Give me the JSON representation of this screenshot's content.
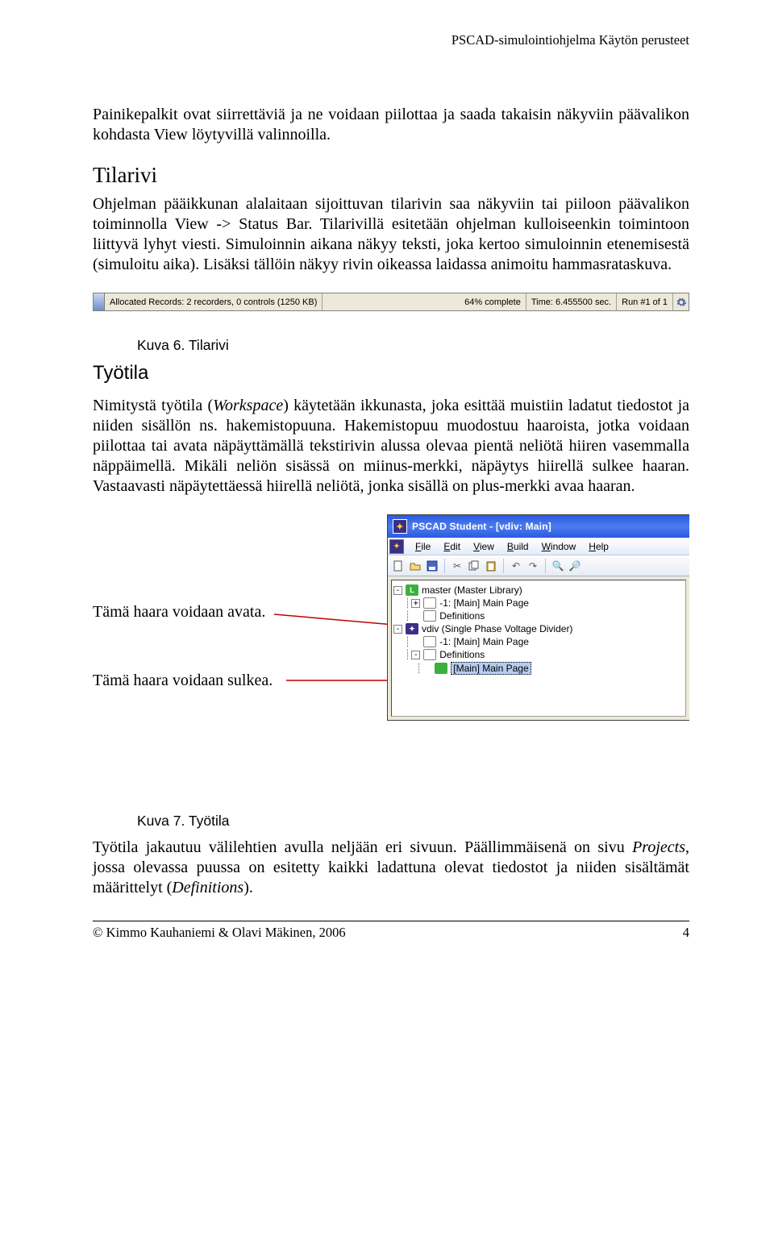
{
  "header": {
    "right": "PSCAD-simulointiohjelma Käytön perusteet"
  },
  "p1": "Painikepalkit ovat siirrettäviä ja ne voidaan piilottaa ja saada takaisin näkyviin päävalikon kohdasta View löytyvillä valinnoilla.",
  "h1": "Tilarivi",
  "p2": "Ohjelman pääikkunan alalaitaan sijoittuvan tilarivin saa näkyviin tai piiloon päävalikon toiminnolla View -> Status Bar. Tilarivillä esitetään ohjelman kulloiseenkin toimintoon liittyvä lyhyt viesti. Simuloinnin aikana näkyy teksti, joka kertoo simuloinnin etenemisestä (simuloitu aika). Lisäksi tällöin näkyy rivin oikeassa laidassa animoitu hammasrataskuva.",
  "statusbar": {
    "records": "Allocated Records: 2 recorders, 0 controls (1250 KB)",
    "progress": "64% complete",
    "time": "Time: 6.455500 sec.",
    "run": "Run #1 of 1"
  },
  "caption6": "Kuva 6. Tilarivi",
  "h2": "Työtila",
  "p3a": "Nimitystä työtila (",
  "p3b": "Workspace",
  "p3c": ") käytetään ikkunasta, joka esittää muistiin ladatut tiedostot ja niiden sisällön ns. hakemistopuuna. Hakemistopuu muodostuu haaroista, jotka voidaan piilottaa tai avata näpäyttämällä tekstirivin alussa olevaa pientä neliötä hiiren vasemmalla näppäimellä. Mikäli neliön sisässä on miinus-merkki, näpäytys hiirellä sulkee haaran. Vastaavasti näpäytettäessä hiirellä neliötä, jonka sisällä on plus-merkki avaa haaran.",
  "callouts": {
    "open": "Tämä haara voidaan avata.",
    "close": "Tämä haara voidaan sulkea."
  },
  "pscad": {
    "title": "PSCAD Student - [vdiv: Main]",
    "menus": [
      "File",
      "Edit",
      "View",
      "Build",
      "Window",
      "Help"
    ],
    "tree": [
      {
        "pm": "-",
        "indent": 0,
        "icon": "ico-green",
        "iconLetter": "L",
        "label": "master (Master Library)"
      },
      {
        "pm": "+",
        "indent": 1,
        "icon": "ico-page",
        "iconLetter": "",
        "label": "-1: [Main] Main Page"
      },
      {
        "pm": "",
        "indent": 1,
        "icon": "ico-page",
        "iconLetter": "",
        "label": "Definitions"
      },
      {
        "pm": "-",
        "indent": 0,
        "icon": "ico-purple",
        "iconLetter": "",
        "label": "vdiv (Single Phase Voltage Divider)"
      },
      {
        "pm": "",
        "indent": 1,
        "icon": "ico-page",
        "iconLetter": "",
        "label": "-1: [Main] Main Page"
      },
      {
        "pm": "-",
        "indent": 1,
        "icon": "ico-page",
        "iconLetter": "",
        "label": "Definitions"
      },
      {
        "pm": "",
        "indent": 2,
        "icon": "ico-green",
        "iconLetter": "",
        "label": "[Main] Main Page",
        "selected": true
      }
    ]
  },
  "caption7": "Kuva 7. Työtila",
  "p4a": "Työtila jakautuu välilehtien avulla neljään eri sivuun. Päällimmäisenä on sivu ",
  "p4b": "Projects",
  "p4c": ", jossa olevassa puussa on esitetty kaikki ladattuna olevat tiedostot ja niiden sisältämät määrittelyt (",
  "p4d": "Definitions",
  "p4e": ").",
  "footer": {
    "left": "© Kimmo Kauhaniemi & Olavi Mäkinen, 2006",
    "right": "4"
  }
}
